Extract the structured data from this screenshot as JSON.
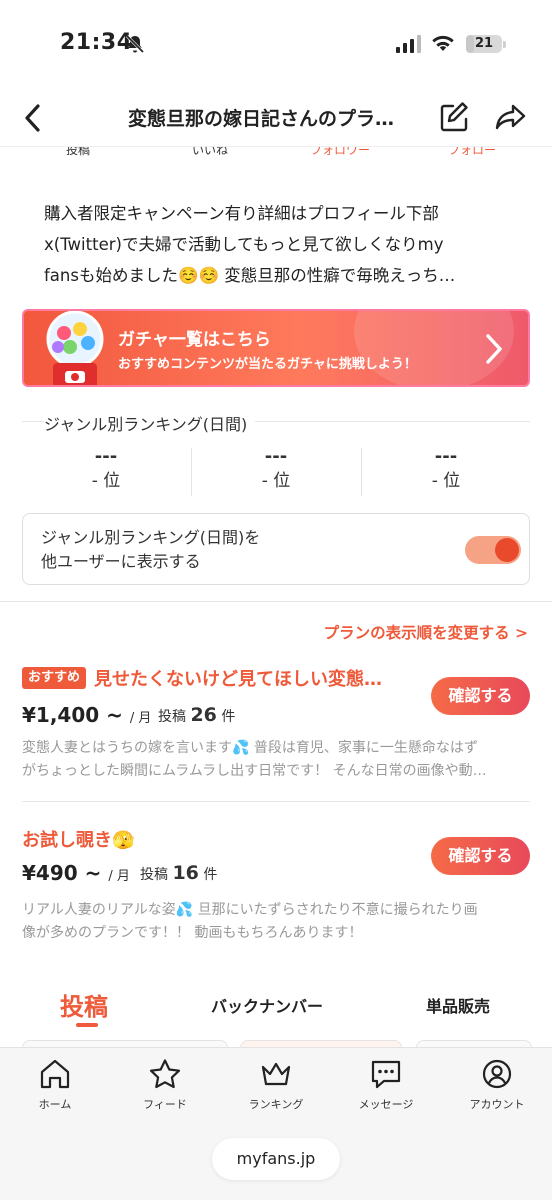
{
  "status_bar": {
    "time": "21:34",
    "battery": "21",
    "battery_fraction": 0.21
  },
  "header": {
    "title": "変態旦那の嫁日記さんのプラ…"
  },
  "stats_labels": [
    "投稿",
    "いいね",
    "フォロワー",
    "フォロー"
  ],
  "bio": {
    "lines": [
      "購入者限定キャンペーン有り詳細はプロフィール下部",
      "x(Twitter)で夫婦で活動してもっと見て欲しくなりmy",
      "fansも始めました☺️☺️ 変態旦那の性癖で毎晩えっち…"
    ]
  },
  "gacha": {
    "title": "ガチャ一覧はこちら",
    "subtitle": "おすすめコンテンツが当たるガチャに挑戦しよう！"
  },
  "ranking": {
    "heading": "ジャンル別ランキング(日間)",
    "cells": [
      {
        "rank": "---",
        "pos": "- 位"
      },
      {
        "rank": "---",
        "pos": "- 位"
      },
      {
        "rank": "---",
        "pos": "- 位"
      }
    ],
    "toggle_text_1": "ジャンル別ランキング(日間)を",
    "toggle_text_2": "他ユーザーに表示する",
    "toggle_on": true
  },
  "plan_order_link": "プランの表示順を変更する >",
  "plans": [
    {
      "badge": "おすすめ",
      "title": "見せたくないけど見てほしい変態…",
      "price": "¥1,400 ~",
      "per": "/ 月",
      "posts_label": "投稿",
      "posts_count": "26",
      "posts_unit": "件",
      "button": "確認する",
      "desc_1": "変態人妻とはうちの嫁を言います💦 普段は育児、家事に一生懸命なはず",
      "desc_2": "がちょっとした瞬間にムラムラし出す日常です！ そんな日常の画像や動…"
    },
    {
      "badge": "",
      "title": "お試し覗き🫣",
      "price": "¥490 ~",
      "per": "/ 月",
      "posts_label": "投稿",
      "posts_count": "16",
      "posts_unit": "件",
      "button": "確認する",
      "desc_1": "リアル人妻のリアルな姿💦 旦那にいたずらされたり不意に撮られたり画",
      "desc_2": "像が多めのプランです！！ 動画ももちろんあります！"
    }
  ],
  "tabs": [
    {
      "label": "投稿",
      "active": true
    },
    {
      "label": "バックナンバー",
      "active": false
    },
    {
      "label": "単品販売",
      "active": false
    }
  ],
  "bottom_nav": [
    {
      "label": "ホーム",
      "icon": "home-icon"
    },
    {
      "label": "フィード",
      "icon": "star-icon"
    },
    {
      "label": "ランキング",
      "icon": "crown-icon"
    },
    {
      "label": "メッセージ",
      "icon": "message-icon"
    },
    {
      "label": "アカウント",
      "icon": "account-icon"
    }
  ],
  "url": "myfans.jp",
  "colors": {
    "accent": "#ee5a3a",
    "toggle_track": "#f6a285",
    "toggle_knob": "#ea4a2c"
  }
}
